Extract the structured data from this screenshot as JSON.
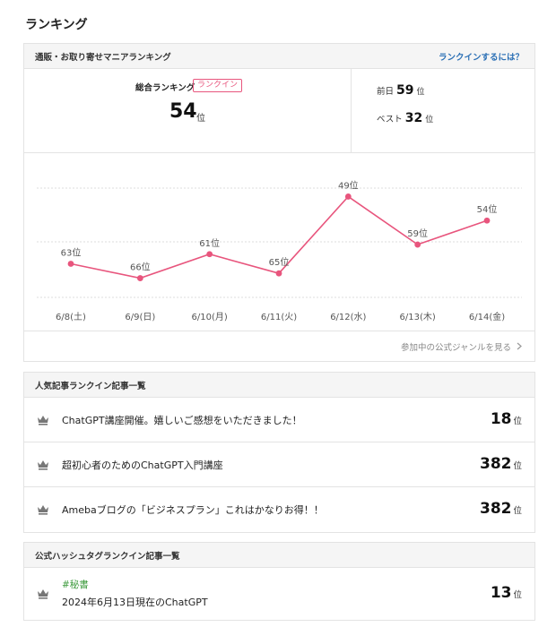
{
  "page": {
    "title": "ランキング"
  },
  "ranking": {
    "header_title": "通販・お取り寄せマニアランキング",
    "header_link": "ランクインするには？",
    "overall_label": "総合ランキング",
    "badge": "ランクイン",
    "overall_value": "54",
    "rank_unit": "位",
    "prev_label": "前日",
    "prev_value": "59",
    "best_label": "ベスト",
    "best_value": "32",
    "footer_link": "参加中の公式ジャンルを見る",
    "footer_chevron": "chevron-right-icon"
  },
  "chart_data": {
    "type": "line",
    "categories": [
      "6/8(土)",
      "6/9(日)",
      "6/10(月)",
      "6/11(火)",
      "6/12(水)",
      "6/13(木)",
      "6/14(金)"
    ],
    "series": [
      {
        "values": [
          63,
          66,
          61,
          65,
          49,
          59,
          54
        ]
      }
    ],
    "value_suffix": "位",
    "y_inverted": true,
    "ylim": [
      70,
      45
    ],
    "grid": true,
    "line_color": "#e8557d"
  },
  "articles": {
    "header_title": "人気記事ランクイン記事一覧",
    "icon": "crown-icon",
    "items": [
      {
        "title": "ChatGPT講座開催。嬉しいご感想をいただきました！",
        "rank": "18",
        "unit": "位"
      },
      {
        "title": "超初心者のためのChatGPT入門講座",
        "rank": "382",
        "unit": "位"
      },
      {
        "title": "Amebaブログの「ビジネスプラン」これはかなりお得！！",
        "rank": "382",
        "unit": "位"
      }
    ]
  },
  "hashtags": {
    "header_title": "公式ハッシュタグランクイン記事一覧",
    "items": [
      {
        "tag": "#秘書",
        "title": "2024年6月13日現在のChatGPT",
        "rank": "13",
        "unit": "位"
      }
    ]
  },
  "colors": {
    "accent": "#e8557d",
    "link": "#2a6fb5",
    "hashtag": "#3b9a3b",
    "crown": "#777777"
  }
}
